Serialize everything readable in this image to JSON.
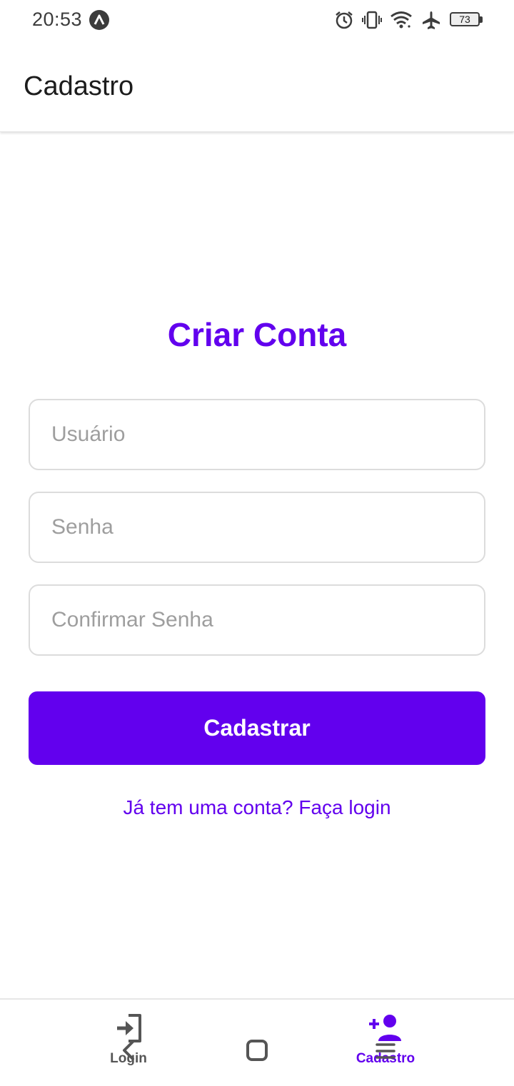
{
  "status_bar": {
    "time": "20:53",
    "battery_level": "73",
    "icons": [
      "app-notification-icon",
      "alarm-icon",
      "vibrate-icon",
      "wifi-icon",
      "airplane-mode-icon",
      "battery-icon"
    ]
  },
  "app_bar": {
    "title": "Cadastro"
  },
  "form": {
    "title": "Criar Conta",
    "username_placeholder": "Usuário",
    "username_value": "",
    "password_placeholder": "Senha",
    "password_value": "",
    "confirm_placeholder": "Confirmar Senha",
    "confirm_value": "",
    "submit_label": "Cadastrar",
    "login_link": "Já tem uma conta? Faça login"
  },
  "tabs": [
    {
      "label": "Login",
      "icon": "login-icon",
      "active": false
    },
    {
      "label": "Cadastro",
      "icon": "person-add-icon",
      "active": true
    }
  ],
  "colors": {
    "accent": "#6200ee",
    "inactive_tab": "#555555",
    "input_border": "#dcdcdc",
    "placeholder": "#9e9e9e"
  }
}
